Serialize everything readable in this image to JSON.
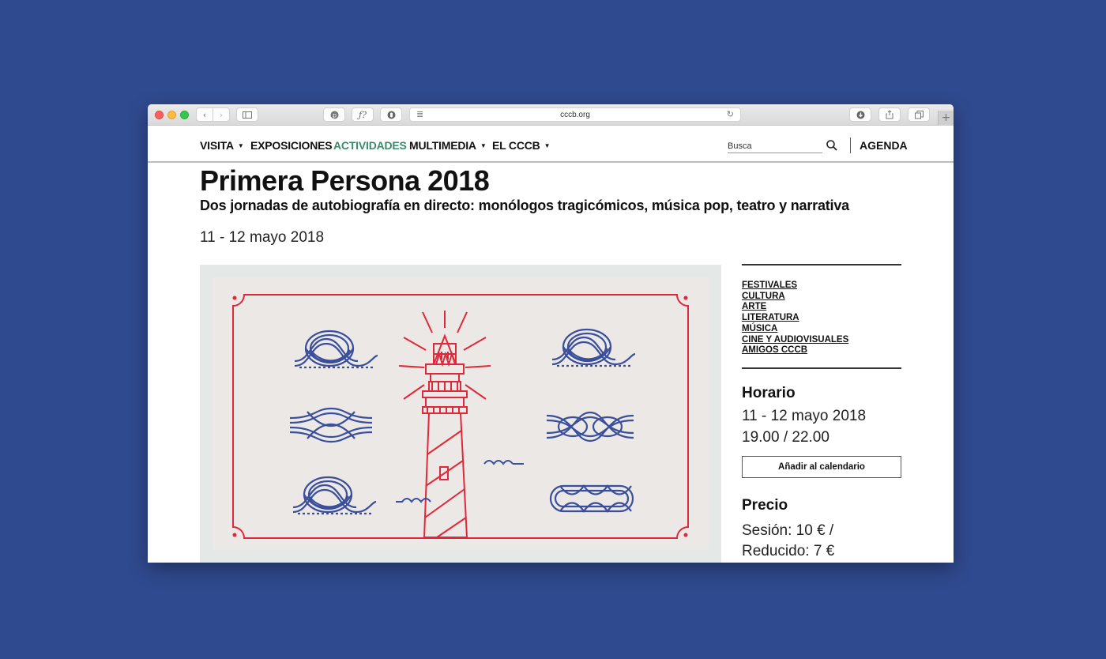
{
  "browser": {
    "url": "cccb.org",
    "toolbar_icons": [
      "back-icon",
      "forward-icon",
      "sidebar-icon",
      "pinterest-icon",
      "font-icon",
      "privacy-icon",
      "reader-icon",
      "reload-icon",
      "download-icon",
      "share-icon",
      "tabs-icon",
      "new-tab-icon"
    ]
  },
  "nav": {
    "items": [
      {
        "label": "VISITA",
        "has_menu": true
      },
      {
        "label": "EXPOSICIONES",
        "has_menu": false
      },
      {
        "label": "ACTIVIDADES",
        "has_menu": false,
        "active": true
      },
      {
        "label": "MULTIMEDIA",
        "has_menu": true
      },
      {
        "label": "EL CCCB",
        "has_menu": true
      }
    ],
    "search_placeholder": "Busca",
    "agenda": "AGENDA",
    "active_color": "#3b8a6b"
  },
  "page": {
    "title": "Primera Persona 2018",
    "subtitle": "Dos jornadas de autobiografía en directo: monólogos tragicómicos, música pop, teatro y narrativa",
    "dates": "11 - 12 mayo 2018"
  },
  "sidebar": {
    "tags": [
      "FESTIVALES",
      "CULTURA",
      "ARTE",
      "LITERATURA",
      "MÚSICA",
      "CINE Y AUDIOVISUALES",
      "AMIGOS CCCB"
    ],
    "horario_title": "Horario",
    "horario_dates": "11 - 12 mayo 2018",
    "horario_time": "19.00 / 22.00",
    "calendar_button": "Añadir al calendario",
    "precio_title": "Precio",
    "precio_line1": "Sesión: 10 € /",
    "precio_line2": "Reducido: 7 €"
  },
  "colors": {
    "background": "#304a8f",
    "poster_bg": "#e4e9e7",
    "poster_card": "#ece8e5",
    "lighthouse_red": "#e0283a",
    "knot_blue": "#3a4f9c"
  }
}
